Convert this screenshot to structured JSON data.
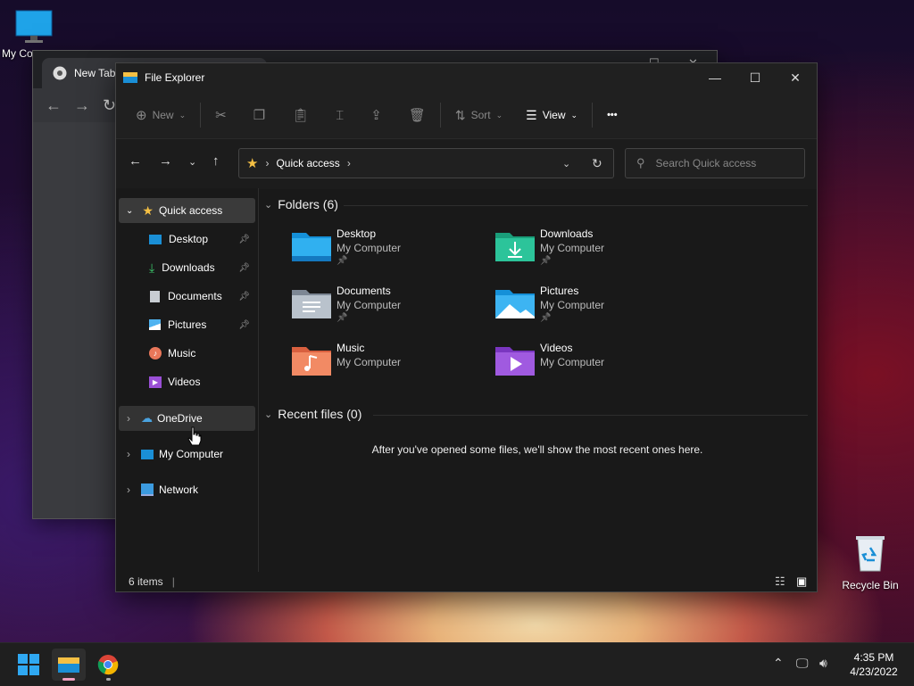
{
  "desktop": {
    "my_computer_label": "My Co",
    "recycle_bin_label": "Recycle Bin"
  },
  "chrome": {
    "tab_title": "New Tab"
  },
  "explorer": {
    "window_title": "File Explorer",
    "commands": {
      "new_label": "New",
      "sort_label": "Sort",
      "view_label": "View",
      "more_label": "•••"
    },
    "address": {
      "path": "Quick access"
    },
    "search": {
      "placeholder": "Search Quick access"
    },
    "nav_pane": {
      "quick_access": "Quick access",
      "items": [
        {
          "label": "Desktop"
        },
        {
          "label": "Downloads"
        },
        {
          "label": "Documents"
        },
        {
          "label": "Pictures"
        },
        {
          "label": "Music"
        },
        {
          "label": "Videos"
        }
      ],
      "onedrive": "OneDrive",
      "my_computer": "My Computer",
      "network": "Network"
    },
    "folders_header": "Folders (6)",
    "folders": [
      {
        "name": "Desktop",
        "location": "My Computer",
        "pinned": "📌"
      },
      {
        "name": "Downloads",
        "location": "My Computer",
        "pinned": "📌"
      },
      {
        "name": "Documents",
        "location": "My Computer",
        "pinned": "📌"
      },
      {
        "name": "Pictures",
        "location": "My Computer",
        "pinned": "📌"
      },
      {
        "name": "Music",
        "location": "My Computer"
      },
      {
        "name": "Videos",
        "location": "My Computer"
      }
    ],
    "recent_header": "Recent files (0)",
    "recent_empty": "After you've opened some files, we'll show the most recent ones here.",
    "status": {
      "item_count": "6 items"
    }
  },
  "taskbar": {
    "time": "4:35 PM",
    "date": "4/23/2022"
  },
  "colors": {
    "accent": "#0078d4",
    "folder_yellow": "#f5c044"
  }
}
